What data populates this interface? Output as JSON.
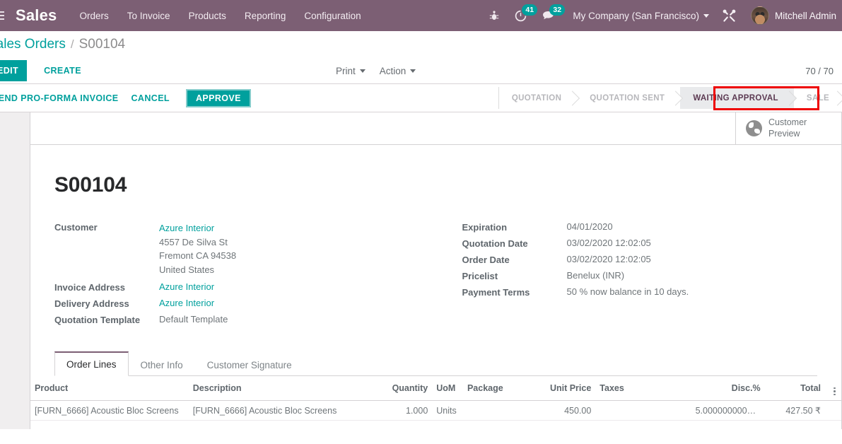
{
  "navbar": {
    "apps_icon": "apps-grid-icon",
    "brand": "Sales",
    "menus": [
      {
        "label": "Orders"
      },
      {
        "label": "To Invoice"
      },
      {
        "label": "Products"
      },
      {
        "label": "Reporting"
      },
      {
        "label": "Configuration"
      }
    ],
    "right": {
      "debug_icon": "bug-icon",
      "activity_icon": "clock-activity-icon",
      "activity_count": "41",
      "messages_icon": "chat-bubble-icon",
      "messages_count": "32",
      "company": "My Company (San Francisco)",
      "tools_icon": "wrench-screwdriver-icon",
      "avatar_icon": "user-avatar",
      "user_name": "Mitchell Admin"
    },
    "accent_color": "#7c5f74"
  },
  "control_panel": {
    "breadcrumb": {
      "parent": "Sales Orders",
      "separator": "/",
      "current": "S00104"
    },
    "edit_label": "EDIT",
    "create_label": "CREATE",
    "print_label": "Print",
    "action_label": "Action",
    "pager": "70 / 70",
    "primary_color": "#00a09d"
  },
  "workflow": {
    "buttons": [
      {
        "label": "SEND PRO-FORMA INVOICE",
        "style": "link"
      },
      {
        "label": "CANCEL",
        "style": "link"
      },
      {
        "label": "APPROVE",
        "style": "primary"
      }
    ],
    "stages": [
      {
        "label": "QUOTATION",
        "state": "done"
      },
      {
        "label": "QUOTATION SENT",
        "state": "done"
      },
      {
        "label": "WAITING APPROVAL",
        "state": "active"
      },
      {
        "label": "SALE",
        "state": "done"
      }
    ],
    "annotation_color": "#ee0000"
  },
  "stat_button": {
    "icon": "globe-icon",
    "line1": "Customer",
    "line2": "Preview"
  },
  "record": {
    "title": "S00104",
    "left_fields": [
      {
        "label": "Customer",
        "value": "Azure Interior",
        "link": true,
        "extra_lines": [
          "4557 De Silva St",
          "Fremont CA 94538",
          "United States"
        ]
      },
      {
        "label": "Invoice Address",
        "value": "Azure Interior",
        "link": true
      },
      {
        "label": "Delivery Address",
        "value": "Azure Interior",
        "link": true
      },
      {
        "label": "Quotation Template",
        "value": "Default Template",
        "link": false
      }
    ],
    "right_fields": [
      {
        "label": "Expiration",
        "value": "04/01/2020"
      },
      {
        "label": "Quotation Date",
        "value": "03/02/2020 12:02:05"
      },
      {
        "label": "Order Date",
        "value": "03/02/2020 12:02:05"
      },
      {
        "label": "Pricelist",
        "value": "Benelux (INR)"
      },
      {
        "label": "Payment Terms",
        "value": "50 % now balance in 10 days."
      }
    ]
  },
  "notebook": {
    "tabs": [
      {
        "label": "Order Lines",
        "active": true
      },
      {
        "label": "Other Info",
        "active": false
      },
      {
        "label": "Customer Signature",
        "active": false
      }
    ]
  },
  "order_lines": {
    "columns": [
      {
        "label": "Product",
        "align": "left"
      },
      {
        "label": "Description",
        "align": "left"
      },
      {
        "label": "Quantity",
        "align": "right"
      },
      {
        "label": "UoM",
        "align": "left"
      },
      {
        "label": "Package",
        "align": "left"
      },
      {
        "label": "Unit Price",
        "align": "right"
      },
      {
        "label": "Taxes",
        "align": "left"
      },
      {
        "label": "Disc.%",
        "align": "right"
      },
      {
        "label": "Total",
        "align": "right"
      }
    ],
    "options_icon": "column-options-icon",
    "rows": [
      {
        "product": "[FURN_6666] Acoustic Bloc Screens",
        "description": "[FURN_6666] Acoustic Bloc Screens",
        "quantity": "1.000",
        "uom": "Units",
        "package": "",
        "unit_price": "450.00",
        "taxes": "",
        "discount": "5.00000000000000266454",
        "total": "427.50 ₹"
      }
    ]
  }
}
